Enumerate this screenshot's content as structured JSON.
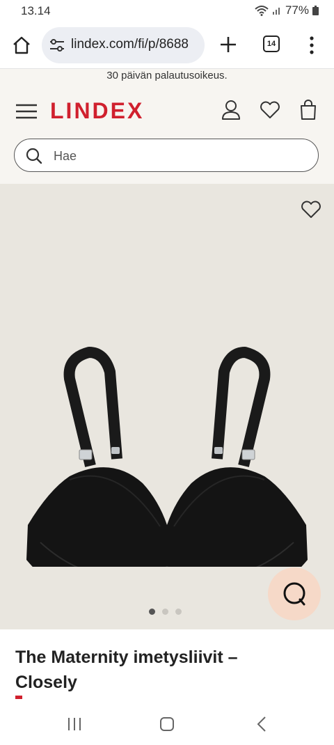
{
  "status_bar": {
    "time": "13.14",
    "battery": "77%",
    "icons": [
      "wifi-icon",
      "signal-icon",
      "battery-icon"
    ]
  },
  "browser": {
    "url": "lindex.com/fi/p/8688",
    "tab_count": "14",
    "icons": [
      "home-icon",
      "site-settings-icon",
      "plus-icon",
      "tabs-icon",
      "more-icon"
    ]
  },
  "site": {
    "promo": "30 päivän palautusoikeus.",
    "logo": "LINDEX",
    "brand_color": "#d0202e",
    "header_icons": [
      "menu-icon",
      "user-icon",
      "heart-icon",
      "bag-icon"
    ],
    "search": {
      "placeholder": "Hae"
    }
  },
  "product": {
    "title": "The Maternity imetysliivit – Closely",
    "image": "black-nursing-bra",
    "gallery_total": 3,
    "gallery_active": 1
  },
  "chat": {
    "icon": "chat-icon",
    "color": "#f6d9c8"
  },
  "nav": {
    "icons": [
      "recents-icon",
      "home-nav-icon",
      "back-icon"
    ]
  }
}
